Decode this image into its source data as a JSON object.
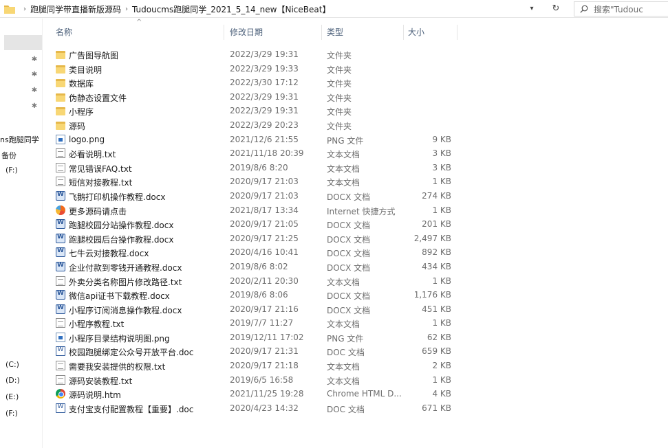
{
  "address_bar": {
    "breadcrumbs": [
      "跑腿同学带直播新版源码",
      "Tudoucms跑腿同学_2021_5_14_new【NiceBeat】"
    ],
    "search_placeholder": "搜索\"Tudouc"
  },
  "nav": {
    "items": [
      "ns跑腿同学",
      "备份",
      "(F:)",
      "(C:)",
      "(D:)",
      "(E:)",
      "(F:)"
    ]
  },
  "columns": {
    "name": "名称",
    "date": "修改日期",
    "type": "类型",
    "size": "大小"
  },
  "files": [
    {
      "name": "广告图导航图",
      "date": "2022/3/29 19:31",
      "type": "文件夹",
      "size": "",
      "icon": "folder"
    },
    {
      "name": "类目说明",
      "date": "2022/3/29 19:33",
      "type": "文件夹",
      "size": "",
      "icon": "folder"
    },
    {
      "name": "数据库",
      "date": "2022/3/30 17:12",
      "type": "文件夹",
      "size": "",
      "icon": "folder"
    },
    {
      "name": "伪静态设置文件",
      "date": "2022/3/29 19:31",
      "type": "文件夹",
      "size": "",
      "icon": "folder"
    },
    {
      "name": "小程序",
      "date": "2022/3/29 19:31",
      "type": "文件夹",
      "size": "",
      "icon": "folder"
    },
    {
      "name": "源码",
      "date": "2022/3/29 20:23",
      "type": "文件夹",
      "size": "",
      "icon": "folder"
    },
    {
      "name": "logo.png",
      "date": "2021/12/6 21:55",
      "type": "PNG 文件",
      "size": "9 KB",
      "icon": "png"
    },
    {
      "name": "必看说明.txt",
      "date": "2021/11/18 20:39",
      "type": "文本文档",
      "size": "3 KB",
      "icon": "txt"
    },
    {
      "name": "常见错误FAQ.txt",
      "date": "2019/8/6 8:20",
      "type": "文本文档",
      "size": "3 KB",
      "icon": "txt"
    },
    {
      "name": "短信对接教程.txt",
      "date": "2020/9/17 21:03",
      "type": "文本文档",
      "size": "1 KB",
      "icon": "txt"
    },
    {
      "name": "飞鹅打印机操作教程.docx",
      "date": "2020/9/17 21:03",
      "type": "DOCX 文档",
      "size": "274 KB",
      "icon": "docx"
    },
    {
      "name": "更多源码请点击",
      "date": "2021/8/17 13:34",
      "type": "Internet 快捷方式",
      "size": "1 KB",
      "icon": "url"
    },
    {
      "name": "跑腿校园分站操作教程.docx",
      "date": "2020/9/17 21:05",
      "type": "DOCX 文档",
      "size": "201 KB",
      "icon": "docx"
    },
    {
      "name": "跑腿校园后台操作教程.docx",
      "date": "2020/9/17 21:25",
      "type": "DOCX 文档",
      "size": "2,497 KB",
      "icon": "docx"
    },
    {
      "name": "七牛云对接教程.docx",
      "date": "2020/4/16 10:41",
      "type": "DOCX 文档",
      "size": "892 KB",
      "icon": "docx"
    },
    {
      "name": "企业付款到零钱开通教程.docx",
      "date": "2019/8/6 8:02",
      "type": "DOCX 文档",
      "size": "434 KB",
      "icon": "docx"
    },
    {
      "name": "外卖分类名称图片修改路径.txt",
      "date": "2020/2/11 20:30",
      "type": "文本文档",
      "size": "1 KB",
      "icon": "txt"
    },
    {
      "name": "微信api证书下载教程.docx",
      "date": "2019/8/6 8:06",
      "type": "DOCX 文档",
      "size": "1,176 KB",
      "icon": "docx"
    },
    {
      "name": "小程序订阅消息操作教程.docx",
      "date": "2020/9/17 21:16",
      "type": "DOCX 文档",
      "size": "451 KB",
      "icon": "docx"
    },
    {
      "name": "小程序教程.txt",
      "date": "2019/7/7 11:27",
      "type": "文本文档",
      "size": "1 KB",
      "icon": "txt"
    },
    {
      "name": "小程序目录结构说明图.png",
      "date": "2019/12/11 17:02",
      "type": "PNG 文件",
      "size": "62 KB",
      "icon": "png"
    },
    {
      "name": "校园跑腿绑定公众号开放平台.doc",
      "date": "2020/9/17 21:31",
      "type": "DOC 文档",
      "size": "659 KB",
      "icon": "doc"
    },
    {
      "name": "需要我安装提供的权限.txt",
      "date": "2020/9/17 21:18",
      "type": "文本文档",
      "size": "2 KB",
      "icon": "txt"
    },
    {
      "name": "源码安装教程.txt",
      "date": "2019/6/5 16:58",
      "type": "文本文档",
      "size": "1 KB",
      "icon": "txt"
    },
    {
      "name": "源码说明.htm",
      "date": "2021/11/25 19:28",
      "type": "Chrome HTML D...",
      "size": "4 KB",
      "icon": "chrome"
    },
    {
      "name": "支付宝支付配置教程【重要】.doc",
      "date": "2020/4/23 14:32",
      "type": "DOC 文档",
      "size": "671 KB",
      "icon": "doc"
    }
  ]
}
